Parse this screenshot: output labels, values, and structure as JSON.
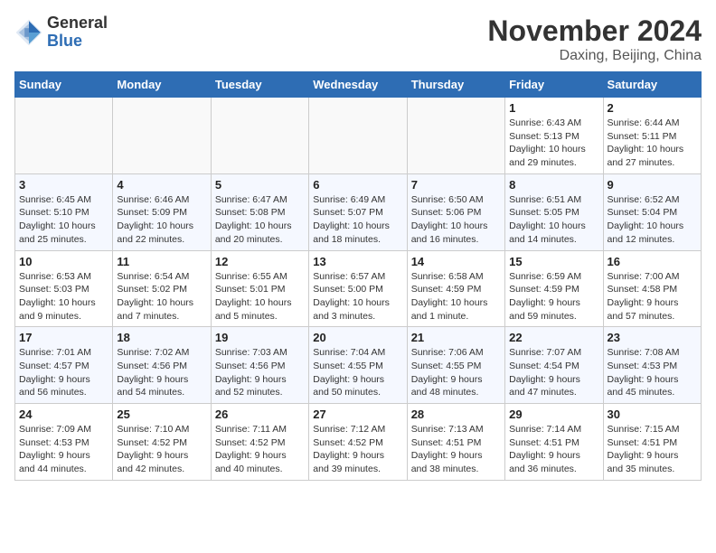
{
  "header": {
    "logo_general": "General",
    "logo_blue": "Blue",
    "month_title": "November 2024",
    "location": "Daxing, Beijing, China"
  },
  "weekdays": [
    "Sunday",
    "Monday",
    "Tuesday",
    "Wednesday",
    "Thursday",
    "Friday",
    "Saturday"
  ],
  "weeks": [
    [
      {
        "day": "",
        "info": ""
      },
      {
        "day": "",
        "info": ""
      },
      {
        "day": "",
        "info": ""
      },
      {
        "day": "",
        "info": ""
      },
      {
        "day": "",
        "info": ""
      },
      {
        "day": "1",
        "info": "Sunrise: 6:43 AM\nSunset: 5:13 PM\nDaylight: 10 hours\nand 29 minutes."
      },
      {
        "day": "2",
        "info": "Sunrise: 6:44 AM\nSunset: 5:11 PM\nDaylight: 10 hours\nand 27 minutes."
      }
    ],
    [
      {
        "day": "3",
        "info": "Sunrise: 6:45 AM\nSunset: 5:10 PM\nDaylight: 10 hours\nand 25 minutes."
      },
      {
        "day": "4",
        "info": "Sunrise: 6:46 AM\nSunset: 5:09 PM\nDaylight: 10 hours\nand 22 minutes."
      },
      {
        "day": "5",
        "info": "Sunrise: 6:47 AM\nSunset: 5:08 PM\nDaylight: 10 hours\nand 20 minutes."
      },
      {
        "day": "6",
        "info": "Sunrise: 6:49 AM\nSunset: 5:07 PM\nDaylight: 10 hours\nand 18 minutes."
      },
      {
        "day": "7",
        "info": "Sunrise: 6:50 AM\nSunset: 5:06 PM\nDaylight: 10 hours\nand 16 minutes."
      },
      {
        "day": "8",
        "info": "Sunrise: 6:51 AM\nSunset: 5:05 PM\nDaylight: 10 hours\nand 14 minutes."
      },
      {
        "day": "9",
        "info": "Sunrise: 6:52 AM\nSunset: 5:04 PM\nDaylight: 10 hours\nand 12 minutes."
      }
    ],
    [
      {
        "day": "10",
        "info": "Sunrise: 6:53 AM\nSunset: 5:03 PM\nDaylight: 10 hours\nand 9 minutes."
      },
      {
        "day": "11",
        "info": "Sunrise: 6:54 AM\nSunset: 5:02 PM\nDaylight: 10 hours\nand 7 minutes."
      },
      {
        "day": "12",
        "info": "Sunrise: 6:55 AM\nSunset: 5:01 PM\nDaylight: 10 hours\nand 5 minutes."
      },
      {
        "day": "13",
        "info": "Sunrise: 6:57 AM\nSunset: 5:00 PM\nDaylight: 10 hours\nand 3 minutes."
      },
      {
        "day": "14",
        "info": "Sunrise: 6:58 AM\nSunset: 4:59 PM\nDaylight: 10 hours\nand 1 minute."
      },
      {
        "day": "15",
        "info": "Sunrise: 6:59 AM\nSunset: 4:59 PM\nDaylight: 9 hours\nand 59 minutes."
      },
      {
        "day": "16",
        "info": "Sunrise: 7:00 AM\nSunset: 4:58 PM\nDaylight: 9 hours\nand 57 minutes."
      }
    ],
    [
      {
        "day": "17",
        "info": "Sunrise: 7:01 AM\nSunset: 4:57 PM\nDaylight: 9 hours\nand 56 minutes."
      },
      {
        "day": "18",
        "info": "Sunrise: 7:02 AM\nSunset: 4:56 PM\nDaylight: 9 hours\nand 54 minutes."
      },
      {
        "day": "19",
        "info": "Sunrise: 7:03 AM\nSunset: 4:56 PM\nDaylight: 9 hours\nand 52 minutes."
      },
      {
        "day": "20",
        "info": "Sunrise: 7:04 AM\nSunset: 4:55 PM\nDaylight: 9 hours\nand 50 minutes."
      },
      {
        "day": "21",
        "info": "Sunrise: 7:06 AM\nSunset: 4:55 PM\nDaylight: 9 hours\nand 48 minutes."
      },
      {
        "day": "22",
        "info": "Sunrise: 7:07 AM\nSunset: 4:54 PM\nDaylight: 9 hours\nand 47 minutes."
      },
      {
        "day": "23",
        "info": "Sunrise: 7:08 AM\nSunset: 4:53 PM\nDaylight: 9 hours\nand 45 minutes."
      }
    ],
    [
      {
        "day": "24",
        "info": "Sunrise: 7:09 AM\nSunset: 4:53 PM\nDaylight: 9 hours\nand 44 minutes."
      },
      {
        "day": "25",
        "info": "Sunrise: 7:10 AM\nSunset: 4:52 PM\nDaylight: 9 hours\nand 42 minutes."
      },
      {
        "day": "26",
        "info": "Sunrise: 7:11 AM\nSunset: 4:52 PM\nDaylight: 9 hours\nand 40 minutes."
      },
      {
        "day": "27",
        "info": "Sunrise: 7:12 AM\nSunset: 4:52 PM\nDaylight: 9 hours\nand 39 minutes."
      },
      {
        "day": "28",
        "info": "Sunrise: 7:13 AM\nSunset: 4:51 PM\nDaylight: 9 hours\nand 38 minutes."
      },
      {
        "day": "29",
        "info": "Sunrise: 7:14 AM\nSunset: 4:51 PM\nDaylight: 9 hours\nand 36 minutes."
      },
      {
        "day": "30",
        "info": "Sunrise: 7:15 AM\nSunset: 4:51 PM\nDaylight: 9 hours\nand 35 minutes."
      }
    ]
  ]
}
